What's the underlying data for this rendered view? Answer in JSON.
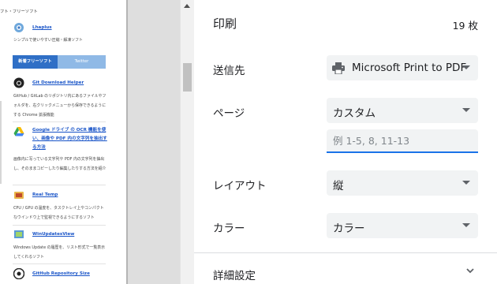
{
  "preview": {
    "header": "フト・フリーソフト",
    "items": [
      {
        "title": "Lhaplus",
        "desc": "シンプルで使いやすい圧縮・解凍ソフト"
      },
      {
        "title": "Git Download Helper",
        "desc": "GitHub / GitLab のリポジトリ内にあるファイルやフォルダを、右クリックメニューから保存できるようにする Chrome 拡張機能"
      },
      {
        "title": "Google ドライブ の OCR 機能を使い、画像や PDF 内の文字列を抽出する方法",
        "desc": "画像内に写っている文字列や PDF 内の文字列を抽出し、そのままコピーしたり編集したりする方法を紹介"
      },
      {
        "title": "Real Temp",
        "desc": "CPU / GPU の温度を、タスクトレイ上やコンパクトなウインドウ上で監視できるようにするソフト"
      },
      {
        "title": "WinUpdatesView",
        "desc": "Windows Update の履歴を、リスト形式で一覧表示してくれるソフト"
      },
      {
        "title": "GitHub Repository Size",
        "desc": ""
      }
    ],
    "tabs": {
      "new": "新着フリーソフト",
      "twitter": "Twitter"
    }
  },
  "panel": {
    "title": "印刷",
    "sheet_count": "19 枚",
    "destination": {
      "label": "送信先",
      "value": "Microsoft Print to PDF"
    },
    "pages": {
      "label": "ページ",
      "value": "カスタム",
      "placeholder": "例 1-5, 8, 11-13"
    },
    "layout": {
      "label": "レイアウト",
      "value": "縦"
    },
    "color": {
      "label": "カラー",
      "value": "カラー"
    },
    "more_settings": "詳細設定"
  },
  "icons": {
    "destination": "printer-icon",
    "more": "chevron-down-icon",
    "dropdown": "dropdown-arrow-icon"
  },
  "colors": {
    "accent": "#1a73e8",
    "select_bg": "#f1f3f4",
    "link": "#1a55c8",
    "tab_active": "#2f6fc6",
    "tab_inactive": "#8fb9e6"
  }
}
